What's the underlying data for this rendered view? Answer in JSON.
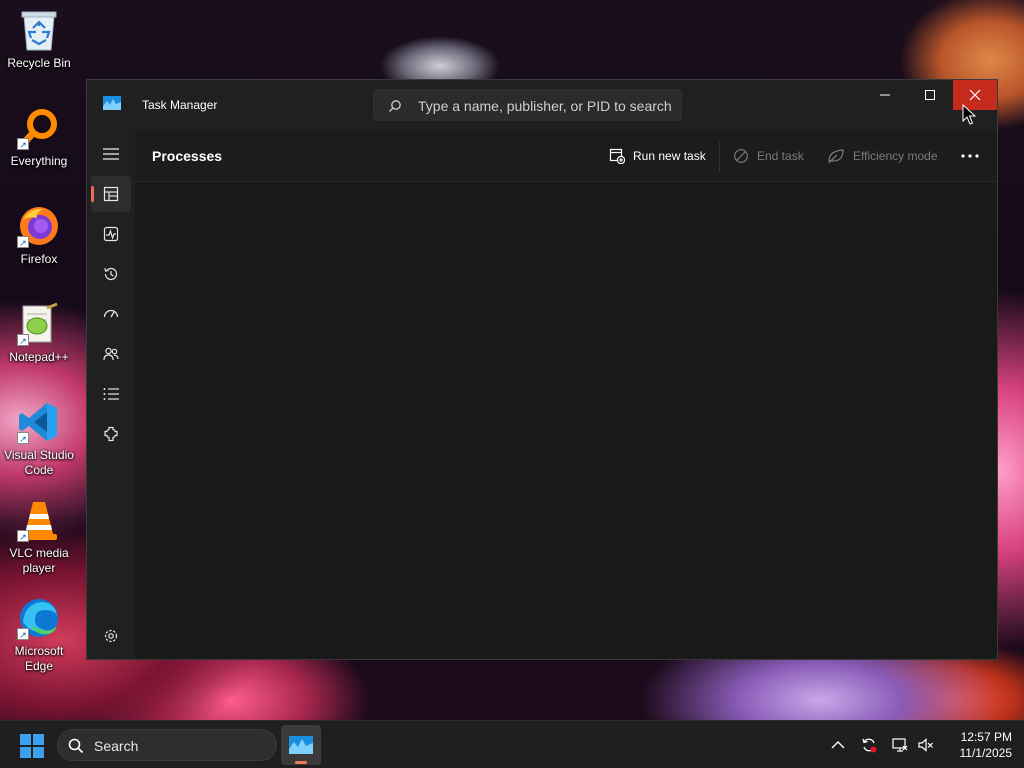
{
  "desktop": {
    "icons": [
      {
        "label": "Recycle Bin",
        "icon": "recycle-bin-icon"
      },
      {
        "label": "Everything",
        "icon": "everything-search-icon"
      },
      {
        "label": "Firefox",
        "icon": "firefox-icon"
      },
      {
        "label": "Notepad++",
        "icon": "notepad-plus-plus-icon"
      },
      {
        "label": "Visual Studio Code",
        "icon": "vscode-icon"
      },
      {
        "label": "VLC media player",
        "icon": "vlc-icon"
      },
      {
        "label": "Microsoft Edge",
        "icon": "edge-icon"
      }
    ]
  },
  "window": {
    "title": "Task Manager",
    "search_placeholder": "Type a name, publisher, or PID to search",
    "controls": {
      "minimize": "minimize-icon",
      "maximize": "maximize-icon",
      "close": "close-icon"
    }
  },
  "sidebar": {
    "items": [
      {
        "icon": "hamburger-menu-icon"
      },
      {
        "icon": "processes-icon",
        "active": true
      },
      {
        "icon": "performance-icon"
      },
      {
        "icon": "app-history-icon"
      },
      {
        "icon": "startup-apps-icon"
      },
      {
        "icon": "users-icon"
      },
      {
        "icon": "details-icon"
      },
      {
        "icon": "services-icon"
      },
      {
        "icon": "settings-icon"
      }
    ]
  },
  "toolbar": {
    "page_title": "Processes",
    "run_new_task": "Run new task",
    "end_task": "End task",
    "efficiency_mode": "Efficiency mode",
    "more": "more-options-icon"
  },
  "taskbar": {
    "search_label": "Search",
    "time": "12:57 PM",
    "date": "11/1/2025"
  },
  "colors": {
    "close_button": "#c42b1c",
    "active_indicator": "#f06a5a",
    "window_bg": "#1c1c1c"
  }
}
